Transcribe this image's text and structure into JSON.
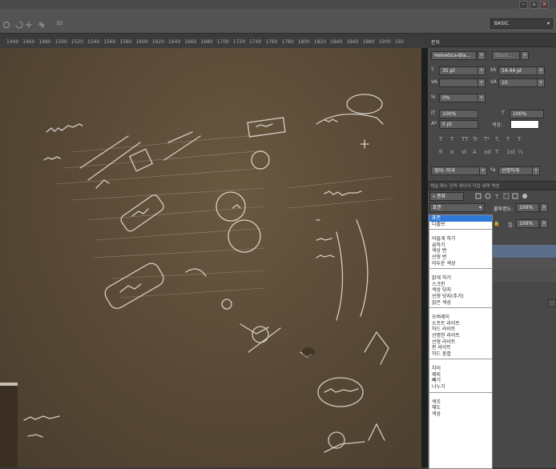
{
  "window": {
    "min_label": "–",
    "max_label": "▫",
    "close_label": "×"
  },
  "options": {
    "workspace": "BASIC",
    "zoom_label": "3D"
  },
  "ruler": {
    "ticks": [
      "1440",
      "1460",
      "1480",
      "1500",
      "1520",
      "1540",
      "1560",
      "1580",
      "1600",
      "1620",
      "1640",
      "1660",
      "1680",
      "1700",
      "1720",
      "1740",
      "1760",
      "1780",
      "1800",
      "1820",
      "1840",
      "1860",
      "1880",
      "1900",
      "192"
    ]
  },
  "character_panel": {
    "tab": "문자",
    "font_family": "Helvetica-Bla...",
    "font_style": "Black...",
    "font_size": "35 pt",
    "leading": "54.44 pt",
    "kerning": "",
    "tracking": "10",
    "scale_pct": "0%",
    "vertical_scale": "100%",
    "horizontal_scale": "100%",
    "baseline_shift": "0 pt",
    "color_label": "색상:",
    "style_glyphs": [
      "T",
      "T",
      "TT",
      "Tr",
      "T¹",
      "T,",
      "T",
      "T"
    ],
    "opentype_glyphs": [
      "fi",
      "ơ",
      "st",
      "A",
      "ad",
      "T",
      "1st",
      "½"
    ],
    "language": "영어: 미국",
    "aa_label": "ªa",
    "antialias": "선명하게"
  },
  "layers_panel": {
    "tabs": "채널  패스  단락  레이어  작업 내역  액션",
    "kind_filter": "종류",
    "blend_mode": "표준",
    "opacity_label": "불투명도:",
    "opacity_value": "100%",
    "fill_label": "칠:",
    "fill_value": "100%"
  },
  "blend_modes": [
    [
      "표준",
      "디졸브"
    ],
    [
      "어둡게 하기",
      "곱하기",
      "색상 번",
      "선형 번",
      "어두운 색상"
    ],
    [
      "밝게 하기",
      "스크린",
      "색상 닷지",
      "선형 닷지(추가)",
      "밝은 색상"
    ],
    [
      "오버레이",
      "소프트 라이트",
      "하드 라이트",
      "선명한 라이트",
      "선형 라이트",
      "핀 라이트",
      "하드 혼합"
    ],
    [
      "차이",
      "제외",
      "빼기",
      "나누기"
    ],
    [
      "색조",
      "채도",
      "색상"
    ]
  ]
}
